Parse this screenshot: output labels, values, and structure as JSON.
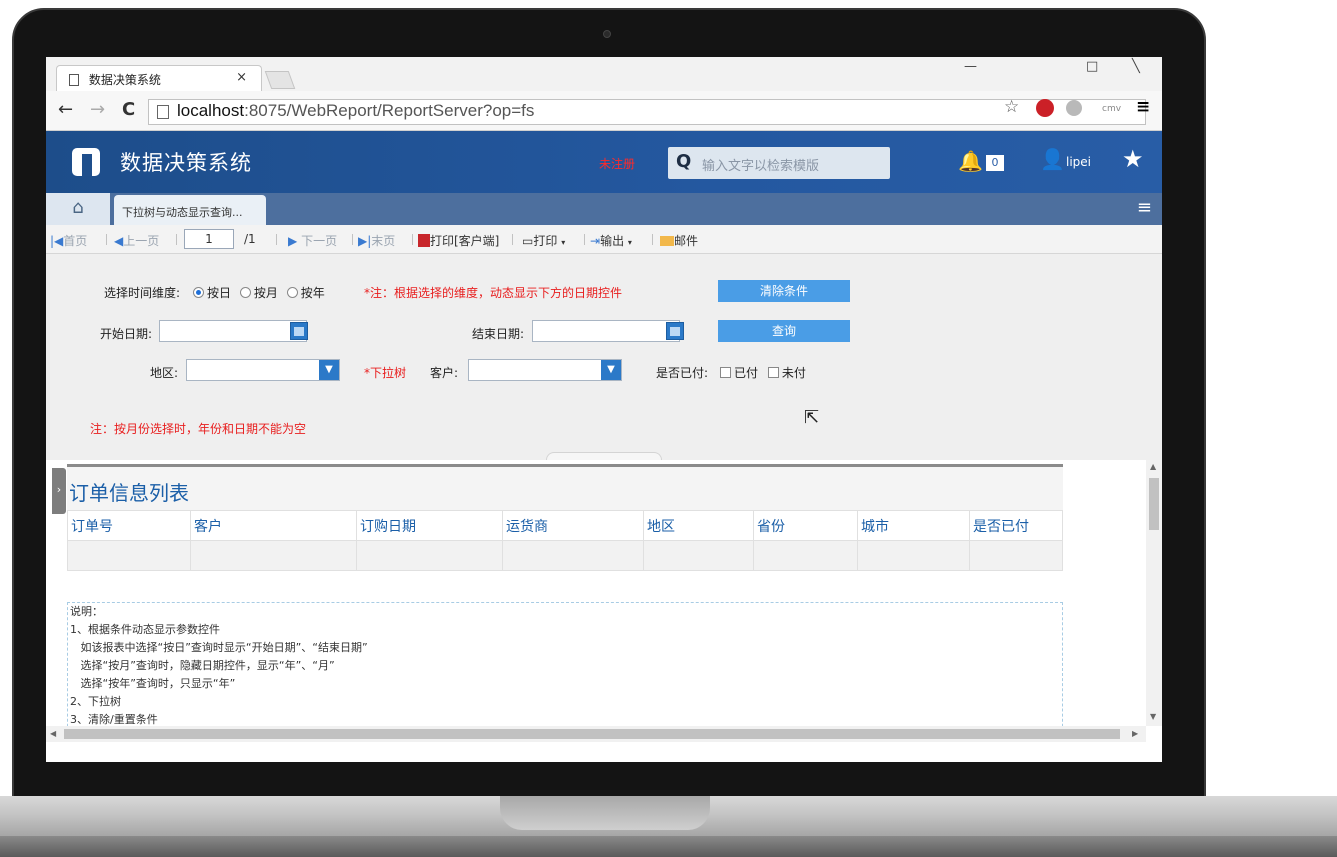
{
  "browser": {
    "tab_title": "数据决策系统",
    "tab_close": "×",
    "url_host": "localhost",
    "url_rest": ":8075/WebReport/ReportServer?op=fs",
    "back": "←",
    "forward": "→",
    "reload": "C",
    "win_min": "—",
    "win_max": "□",
    "win_close": "╲",
    "star_icon": "☆",
    "menu_icon": "≡",
    "ext_label": "cmv"
  },
  "app": {
    "title": "数据决策系统",
    "unregistered": "未注册",
    "search_placeholder": "输入文字以检索模版",
    "search_icon_glyph": "Q",
    "notify_count": "0",
    "user": "lipei",
    "accent": "#2458a0"
  },
  "tabstrip": {
    "home_glyph": "⌂",
    "report_tab": "下拉树与动态显示查询...",
    "menu_glyph": "≡"
  },
  "toolbar": {
    "first": "首页",
    "prev": "上一页",
    "page": "1",
    "total": "/1",
    "next": "下一页",
    "last": "末页",
    "print_client": "打印[客户端]",
    "print": "打印",
    "export": "输出",
    "mail": "邮件"
  },
  "params": {
    "dimension_label": "选择时间维度:",
    "by_day": "按日",
    "by_month": "按月",
    "by_year": "按年",
    "dimension_note": "*注：根据选择的维度，动态显示下方的日期控件",
    "clear_button": "清除条件",
    "start_label": "开始日期:",
    "end_label": "结束日期:",
    "query_button": "查询",
    "region_label": "地区:",
    "tree_note": "*下拉树",
    "customer_label": "客户:",
    "paid_label": "是否已付:",
    "paid": "已付",
    "unpaid": "未付",
    "month_note": "注：按月份选择时，年份和日期不能为空"
  },
  "report": {
    "title": "订单信息列表",
    "columns": [
      "订单号",
      "客户",
      "订购日期",
      "运货商",
      "地区",
      "省份",
      "城市",
      "是否已付"
    ],
    "notes": [
      "说明：",
      "1、根据条件动态显示参数控件",
      "   如该报表中选择“按日”查询时显示“开始日期”、“结束日期”",
      "   选择“按月”查询时，隐藏日期控件，显示“年”、“月”",
      "   选择“按年”查询时，只显示“年”",
      "2、下拉树",
      "3、清除/重置条件"
    ]
  }
}
